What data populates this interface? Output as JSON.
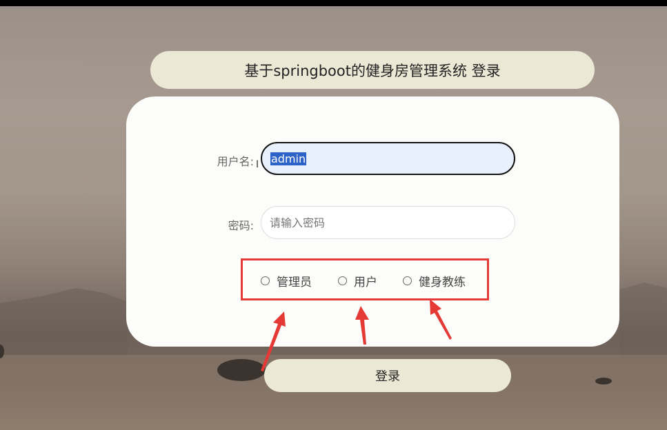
{
  "title": "基于springboot的健身房管理系统 登录",
  "form": {
    "username_label": "用户名:",
    "username_value": "admin",
    "password_label": "密码:",
    "password_placeholder": "请输入密码"
  },
  "roles": [
    {
      "label": "管理员"
    },
    {
      "label": "用户"
    },
    {
      "label": "健身教练"
    }
  ],
  "login_label": "登录",
  "colors": {
    "annotation": "#e53935",
    "panel": "#fcfcfa",
    "button": "#ece8d6"
  }
}
